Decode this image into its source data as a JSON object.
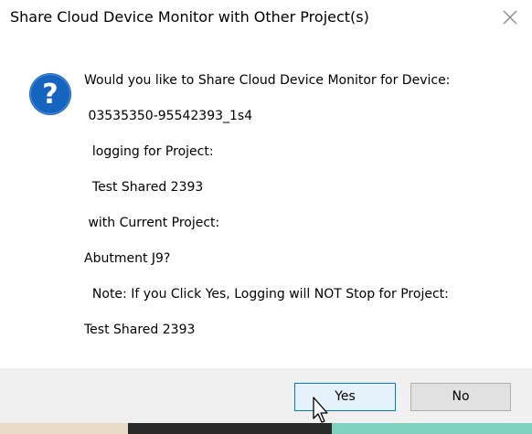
{
  "dialog": {
    "title": "Share Cloud Device Monitor with Other Project(s)",
    "icon": "question-icon",
    "message_lines": [
      "Would you like to Share Cloud Device Monitor for Device:",
      " 03535350-95542393_1s4",
      "  logging for Project:",
      "  Test Shared 2393",
      " with Current Project:",
      "Abutment J9?",
      "  Note: If you Click Yes, Logging will NOT Stop for Project:",
      "Test Shared 2393"
    ],
    "buttons": {
      "yes": "Yes",
      "no": "No"
    },
    "close_icon": "close-icon"
  },
  "colors": {
    "question_icon_blue": "#1565c0",
    "default_button_border": "#0078d7",
    "footer_bg": "#f0f0f0"
  }
}
